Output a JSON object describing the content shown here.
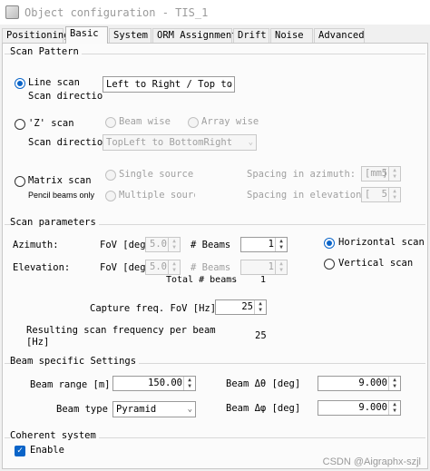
{
  "window": {
    "title": "Object configuration - TIS_1"
  },
  "tabs": [
    {
      "label": "Positioning"
    },
    {
      "label": "Basic",
      "active": true
    },
    {
      "label": "System"
    },
    {
      "label": "ORM Assignment"
    },
    {
      "label": "Drift"
    },
    {
      "label": "Noise"
    },
    {
      "label": "Advanced"
    }
  ],
  "scan_pattern": {
    "title": "Scan Pattern",
    "line_scan": {
      "label": "Line scan",
      "selected": true,
      "direction_label": "Scan directio",
      "direction_value": "Left to Right / Top to"
    },
    "z_scan": {
      "label": "'Z' scan",
      "selected": false,
      "beam_wise": "Beam wise",
      "array_wise": "Array wise",
      "direction_label": "Scan directio",
      "direction_value": "TopLeft to BottomRight"
    },
    "matrix_scan": {
      "label": "Matrix scan",
      "selected": false,
      "sublabel": "Pencil beams only",
      "single_source": "Single source",
      "multiple_source": "Multiple source",
      "spacing_azimuth_label": "Spacing in azimuth:",
      "spacing_azimuth_unit": "[mm]",
      "spacing_azimuth_value": "5",
      "spacing_elevation_label": "Spacing in elevation:",
      "spacing_elevation_unit": "[",
      "spacing_elevation_value": "5"
    }
  },
  "scan_parameters": {
    "title": "Scan parameters",
    "azimuth": {
      "label": "Azimuth:",
      "fov_label": "FoV [deg]",
      "fov_value": "5.0",
      "beams_label": "# Beams",
      "beams_value": "1"
    },
    "elevation": {
      "label": "Elevation:",
      "fov_label": "FoV [deg]",
      "fov_value": "5.0",
      "beams_label": "# Beams",
      "beams_value": "1"
    },
    "total_label": "Total # beams",
    "total_value": "1",
    "horizontal": {
      "label": "Horizontal scan",
      "selected": true
    },
    "vertical": {
      "label": "Vertical scan",
      "selected": false
    },
    "capture_label": "Capture freq. FoV [Hz]",
    "capture_value": "25",
    "result_label_1": "Resulting scan frequency per beam",
    "result_label_2": "[Hz]",
    "result_value": "25"
  },
  "beam_settings": {
    "title": "Beam specific Settings",
    "range_label": "Beam range [m]",
    "range_value": "150.00",
    "type_label": "Beam type",
    "type_value": "Pyramid",
    "dtheta_label": "Beam  Δθ [deg]",
    "dtheta_value": "9.000",
    "dphi_label": "Beam  Δφ [deg]",
    "dphi_value": "9.000"
  },
  "coherent": {
    "title": "Coherent system",
    "enable_label": "Enable",
    "enabled": true
  },
  "watermark": "CSDN @Aigraphx-szjl"
}
